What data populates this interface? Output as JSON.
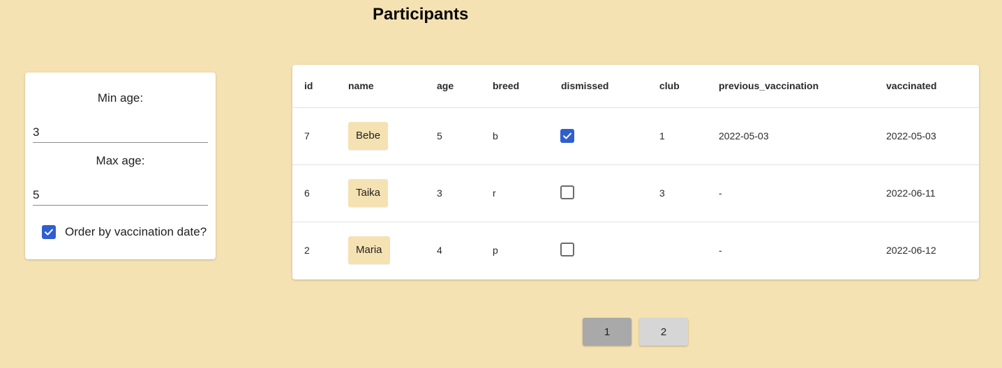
{
  "page": {
    "title": "Participants"
  },
  "filters": {
    "min_age_label": "Min age:",
    "min_age_value": "3",
    "max_age_label": "Max age:",
    "max_age_value": "5",
    "order_label": "Order by vaccination date?",
    "order_checked": true
  },
  "table": {
    "headers": [
      "id",
      "name",
      "age",
      "breed",
      "dismissed",
      "club",
      "previous_vaccination",
      "vaccinated"
    ],
    "rows": [
      {
        "id": "7",
        "name": "Bebe",
        "age": "5",
        "breed": "b",
        "dismissed": true,
        "club": "1",
        "previous_vaccination": "2022-05-03",
        "vaccinated": "2022-05-03"
      },
      {
        "id": "6",
        "name": "Taika",
        "age": "3",
        "breed": "r",
        "dismissed": false,
        "club": "3",
        "previous_vaccination": "-",
        "vaccinated": "2022-06-11"
      },
      {
        "id": "2",
        "name": "Maria",
        "age": "4",
        "breed": "p",
        "dismissed": false,
        "club": "",
        "previous_vaccination": "-",
        "vaccinated": "2022-06-12"
      }
    ]
  },
  "pagination": {
    "pages": [
      "1",
      "2"
    ],
    "current": "1"
  },
  "colors": {
    "background": "#f5e2b2",
    "checkbox_accent": "#2f5fcf",
    "active_page": "#a9a9a9",
    "inactive_page": "#d6d6d6"
  }
}
